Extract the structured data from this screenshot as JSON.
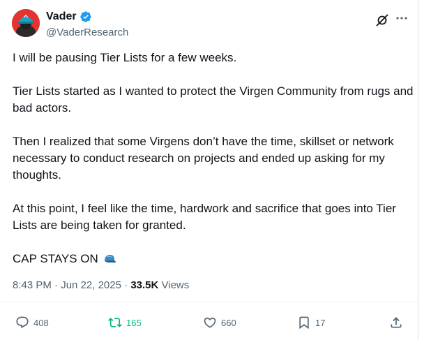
{
  "author": {
    "name": "Vader",
    "handle": "@VaderResearch"
  },
  "tweet": {
    "paragraphs": [
      "I will be pausing Tier Lists for a few weeks.",
      "Tier Lists started as I wanted to protect the Virgen Community from rugs and bad actors.",
      "Then I realized that some Virgens don’t have the time, skillset or network necessary to conduct research on projects and ended up asking for my thoughts.",
      "At this point, I feel like the time, hardwork and sacrifice that goes into Tier Lists are being taken for granted.",
      "CAP STAYS ON"
    ],
    "time": "8:43 PM",
    "date": "Jun 22, 2025",
    "separator": "·",
    "views_count": "33.5K",
    "views_label": "Views"
  },
  "actions": {
    "replies": "408",
    "reposts": "165",
    "likes": "660",
    "bookmarks": "17"
  },
  "colors": {
    "verified": "#1d9bf0",
    "repost_active": "#00ba7c",
    "secondary_text": "#536471",
    "avatar_bg": "#e3342f"
  },
  "icons": [
    "verified-badge-icon",
    "grok-icon",
    "more-icon",
    "blue-cap-emoji",
    "reply-icon",
    "repost-icon",
    "like-icon",
    "bookmark-icon",
    "share-icon"
  ]
}
